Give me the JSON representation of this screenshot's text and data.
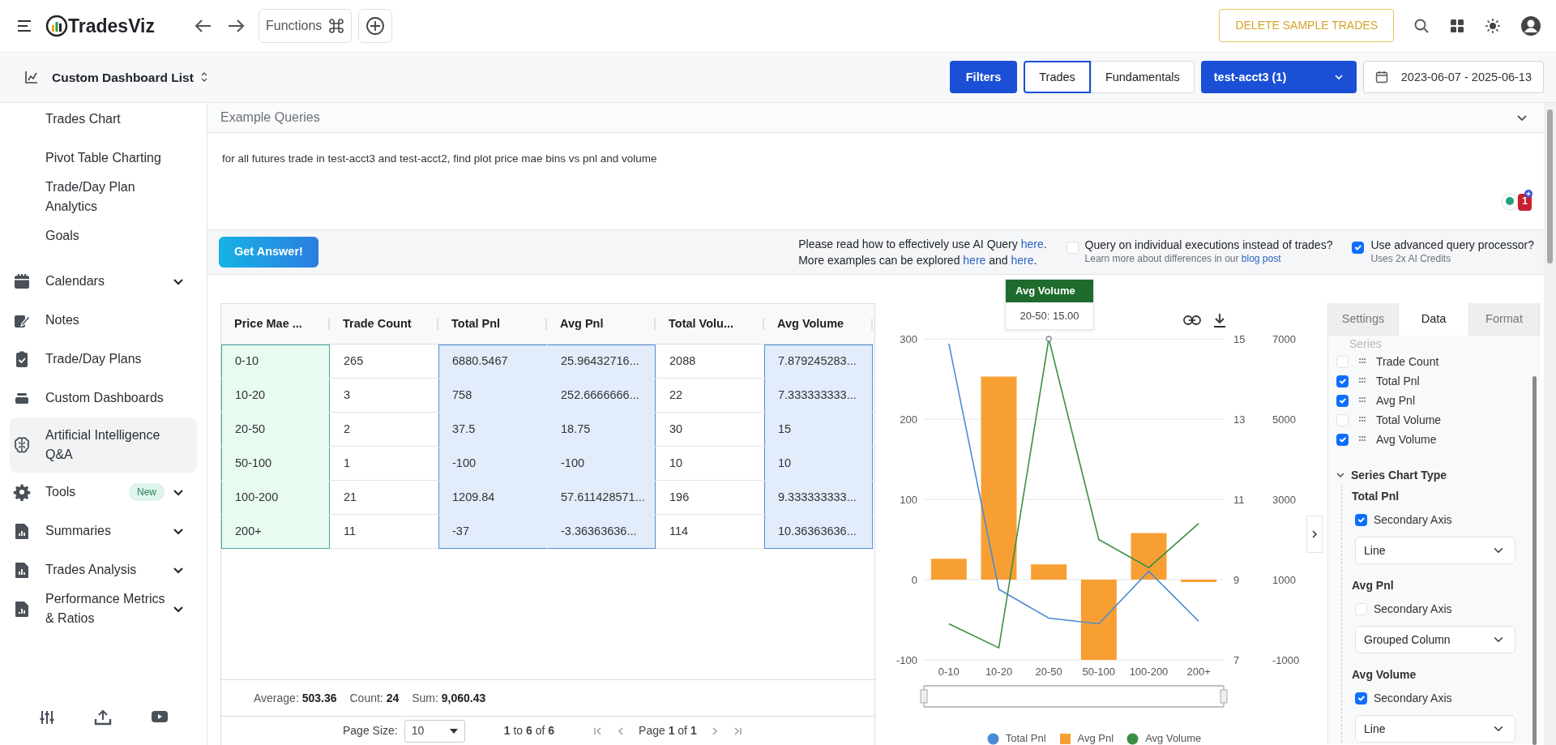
{
  "navbar": {
    "brand": "TradesViz",
    "functions_label": "Functions",
    "delete_button": "DELETE SAMPLE TRADES"
  },
  "toolbar": {
    "dashboard_title": "Custom Dashboard List",
    "filters_button": "Filters",
    "tabs": [
      {
        "label": "Trades",
        "selected": true
      },
      {
        "label": "Fundamentals",
        "selected": false
      }
    ],
    "account": "test-acct3 (1)",
    "date_range": "2023-06-07 - 2025-06-13"
  },
  "sidebar": {
    "items": [
      {
        "label": "Trades Chart",
        "kind": "sub",
        "selected": false
      },
      {
        "label": "Pivot Table Charting",
        "kind": "sub",
        "selected": false
      },
      {
        "label": "Trade/Day Plan Analytics",
        "kind": "sub",
        "selected": false
      },
      {
        "label": "Goals",
        "kind": "sub",
        "selected": false
      },
      {
        "label": "Calendars",
        "kind": "group",
        "selected": false
      },
      {
        "label": "Notes",
        "kind": "link",
        "selected": false
      },
      {
        "label": "Trade/Day Plans",
        "kind": "link",
        "selected": false
      },
      {
        "label": "Custom Dashboards",
        "kind": "link",
        "selected": false
      },
      {
        "label": "Artificial Intelligence Q&A",
        "kind": "link",
        "selected": true
      },
      {
        "label": "Tools",
        "kind": "group",
        "selected": false,
        "badge": "New"
      },
      {
        "label": "Summaries",
        "kind": "group",
        "selected": false
      },
      {
        "label": "Trades Analysis",
        "kind": "group",
        "selected": false
      },
      {
        "label": "Performance Metrics & Ratios",
        "kind": "group",
        "selected": false
      }
    ]
  },
  "query": {
    "example_header": "Example Queries",
    "text": "for all futures trade in test-acct3 and test-acct2, find plot price mae bins vs pnl and volume",
    "notification_count": "1",
    "get_answer": "Get Answer!",
    "help_lines": [
      [
        {
          "text": "Please read how to effectively use AI Query "
        },
        {
          "link": "here"
        },
        {
          "text": "."
        }
      ],
      [
        {
          "text": "More examples can be explored "
        },
        {
          "link": "here"
        },
        {
          "text": " and "
        },
        {
          "link": "here"
        },
        {
          "text": "."
        }
      ]
    ],
    "options": [
      {
        "label": "Query on individual executions instead of trades?",
        "checked": false,
        "note": [
          {
            "text": "Learn more about differences in our "
          },
          {
            "link": "blog post"
          }
        ]
      },
      {
        "label": "Use advanced query processor?",
        "checked": true,
        "note": [
          {
            "text": "Uses 2x AI Credits"
          }
        ]
      }
    ]
  },
  "table": {
    "columns": [
      {
        "label": "Price Mae ...",
        "selected": true,
        "color": "#4aa7a0"
      },
      {
        "label": "Trade Count",
        "selected": false
      },
      {
        "label": "Total Pnl",
        "selected": true,
        "color": "#4f8fd1"
      },
      {
        "label": "Avg Pnl",
        "selected": true,
        "color": "#4f8fd1"
      },
      {
        "label": "Total Volu...",
        "selected": false
      },
      {
        "label": "Avg Volume",
        "selected": true,
        "color": "#4f8fd1"
      }
    ],
    "rows": [
      [
        "0-10",
        "265",
        "6880.5467",
        "25.96432716...",
        "2088",
        "7.879245283..."
      ],
      [
        "10-20",
        "3",
        "758",
        "252.6666666...",
        "22",
        "7.333333333..."
      ],
      [
        "20-50",
        "2",
        "37.5",
        "18.75",
        "30",
        "15"
      ],
      [
        "50-100",
        "1",
        "-100",
        "-100",
        "10",
        "10"
      ],
      [
        "100-200",
        "21",
        "1209.84",
        "57.611428571...",
        "196",
        "9.333333333..."
      ],
      [
        "200+",
        "11",
        "-37",
        "-3.36363636...",
        "114",
        "10.36363636..."
      ]
    ],
    "summary": [
      {
        "label": "Average:",
        "value": "503.36"
      },
      {
        "label": "Count:",
        "value": "24"
      },
      {
        "label": "Sum:",
        "value": "9,060.43"
      }
    ],
    "pagination": {
      "page_size_label": "Page Size:",
      "page_size": "10",
      "range": "**1** to **6** of **6**",
      "page": "Page **1** of **1**"
    }
  },
  "chart": {
    "tooltip": {
      "title": "Avg Volume",
      "text": "20-50: 15.00"
    },
    "chart_data": {
      "type": "bar",
      "categories": [
        "0-10",
        "10-20",
        "20-50",
        "50-100",
        "100-200",
        "200+"
      ],
      "series": [
        {
          "name": "Total Pnl",
          "color": "#4a8bd6",
          "type": "line",
          "axis": "y3",
          "values": [
            6880,
            760,
            40,
            -100,
            1210,
            -40
          ]
        },
        {
          "name": "Avg Pnl",
          "color": "#f89f33",
          "axis": "y",
          "values": [
            26,
            253,
            19,
            -100,
            58,
            -3
          ]
        },
        {
          "name": "Avg Volume",
          "color": "#3a8f45",
          "type": "line",
          "axis": "y2",
          "values": [
            7.9,
            7.3,
            15,
            10,
            9.3,
            10.4
          ]
        }
      ],
      "grid": true,
      "legend": "bottom",
      "ylim": [
        -100,
        300
      ],
      "yticks": [
        -100,
        0,
        100,
        200,
        300
      ],
      "y2lim": [
        7,
        15
      ],
      "y2ticks": [
        7,
        9,
        11,
        13,
        15
      ],
      "y3lim": [
        -1000,
        7000
      ],
      "y3ticks": [
        -1000,
        1000,
        3000,
        5000,
        7000
      ]
    }
  },
  "panel": {
    "tabs": [
      {
        "label": "Settings",
        "selected": false
      },
      {
        "label": "Data",
        "selected": true
      },
      {
        "label": "Format",
        "selected": false
      }
    ],
    "series_header": "Series",
    "series": [
      {
        "label": "Trade Count",
        "checked": false
      },
      {
        "label": "Total Pnl",
        "checked": true
      },
      {
        "label": "Avg Pnl",
        "checked": true
      },
      {
        "label": "Total Volume",
        "checked": false
      },
      {
        "label": "Avg Volume",
        "checked": true
      }
    ],
    "chart_type_header": "Series Chart Type",
    "chart_types": [
      {
        "name": "Total Pnl",
        "secondary_label": "Secondary Axis",
        "secondary": true,
        "type": "Line"
      },
      {
        "name": "Avg Pnl",
        "secondary_label": "Secondary Axis",
        "secondary": false,
        "type": "Grouped Column"
      },
      {
        "name": "Avg Volume",
        "secondary_label": "Secondary Axis",
        "secondary": true,
        "type": "Line"
      }
    ]
  }
}
